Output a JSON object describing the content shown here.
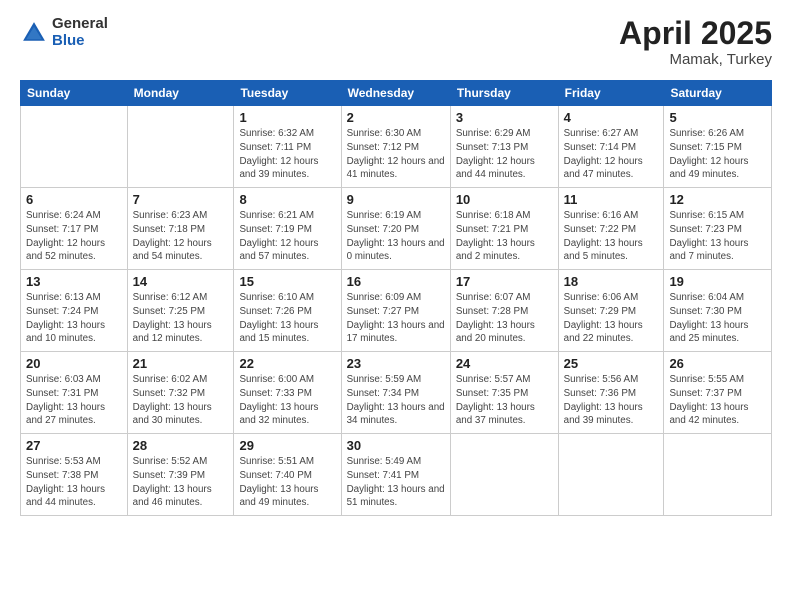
{
  "logo": {
    "general": "General",
    "blue": "Blue"
  },
  "title": {
    "month": "April 2025",
    "location": "Mamak, Turkey"
  },
  "days_of_week": [
    "Sunday",
    "Monday",
    "Tuesday",
    "Wednesday",
    "Thursday",
    "Friday",
    "Saturday"
  ],
  "weeks": [
    [
      {
        "day": "",
        "info": ""
      },
      {
        "day": "",
        "info": ""
      },
      {
        "day": "1",
        "info": "Sunrise: 6:32 AM\nSunset: 7:11 PM\nDaylight: 12 hours and 39 minutes."
      },
      {
        "day": "2",
        "info": "Sunrise: 6:30 AM\nSunset: 7:12 PM\nDaylight: 12 hours and 41 minutes."
      },
      {
        "day": "3",
        "info": "Sunrise: 6:29 AM\nSunset: 7:13 PM\nDaylight: 12 hours and 44 minutes."
      },
      {
        "day": "4",
        "info": "Sunrise: 6:27 AM\nSunset: 7:14 PM\nDaylight: 12 hours and 47 minutes."
      },
      {
        "day": "5",
        "info": "Sunrise: 6:26 AM\nSunset: 7:15 PM\nDaylight: 12 hours and 49 minutes."
      }
    ],
    [
      {
        "day": "6",
        "info": "Sunrise: 6:24 AM\nSunset: 7:17 PM\nDaylight: 12 hours and 52 minutes."
      },
      {
        "day": "7",
        "info": "Sunrise: 6:23 AM\nSunset: 7:18 PM\nDaylight: 12 hours and 54 minutes."
      },
      {
        "day": "8",
        "info": "Sunrise: 6:21 AM\nSunset: 7:19 PM\nDaylight: 12 hours and 57 minutes."
      },
      {
        "day": "9",
        "info": "Sunrise: 6:19 AM\nSunset: 7:20 PM\nDaylight: 13 hours and 0 minutes."
      },
      {
        "day": "10",
        "info": "Sunrise: 6:18 AM\nSunset: 7:21 PM\nDaylight: 13 hours and 2 minutes."
      },
      {
        "day": "11",
        "info": "Sunrise: 6:16 AM\nSunset: 7:22 PM\nDaylight: 13 hours and 5 minutes."
      },
      {
        "day": "12",
        "info": "Sunrise: 6:15 AM\nSunset: 7:23 PM\nDaylight: 13 hours and 7 minutes."
      }
    ],
    [
      {
        "day": "13",
        "info": "Sunrise: 6:13 AM\nSunset: 7:24 PM\nDaylight: 13 hours and 10 minutes."
      },
      {
        "day": "14",
        "info": "Sunrise: 6:12 AM\nSunset: 7:25 PM\nDaylight: 13 hours and 12 minutes."
      },
      {
        "day": "15",
        "info": "Sunrise: 6:10 AM\nSunset: 7:26 PM\nDaylight: 13 hours and 15 minutes."
      },
      {
        "day": "16",
        "info": "Sunrise: 6:09 AM\nSunset: 7:27 PM\nDaylight: 13 hours and 17 minutes."
      },
      {
        "day": "17",
        "info": "Sunrise: 6:07 AM\nSunset: 7:28 PM\nDaylight: 13 hours and 20 minutes."
      },
      {
        "day": "18",
        "info": "Sunrise: 6:06 AM\nSunset: 7:29 PM\nDaylight: 13 hours and 22 minutes."
      },
      {
        "day": "19",
        "info": "Sunrise: 6:04 AM\nSunset: 7:30 PM\nDaylight: 13 hours and 25 minutes."
      }
    ],
    [
      {
        "day": "20",
        "info": "Sunrise: 6:03 AM\nSunset: 7:31 PM\nDaylight: 13 hours and 27 minutes."
      },
      {
        "day": "21",
        "info": "Sunrise: 6:02 AM\nSunset: 7:32 PM\nDaylight: 13 hours and 30 minutes."
      },
      {
        "day": "22",
        "info": "Sunrise: 6:00 AM\nSunset: 7:33 PM\nDaylight: 13 hours and 32 minutes."
      },
      {
        "day": "23",
        "info": "Sunrise: 5:59 AM\nSunset: 7:34 PM\nDaylight: 13 hours and 34 minutes."
      },
      {
        "day": "24",
        "info": "Sunrise: 5:57 AM\nSunset: 7:35 PM\nDaylight: 13 hours and 37 minutes."
      },
      {
        "day": "25",
        "info": "Sunrise: 5:56 AM\nSunset: 7:36 PM\nDaylight: 13 hours and 39 minutes."
      },
      {
        "day": "26",
        "info": "Sunrise: 5:55 AM\nSunset: 7:37 PM\nDaylight: 13 hours and 42 minutes."
      }
    ],
    [
      {
        "day": "27",
        "info": "Sunrise: 5:53 AM\nSunset: 7:38 PM\nDaylight: 13 hours and 44 minutes."
      },
      {
        "day": "28",
        "info": "Sunrise: 5:52 AM\nSunset: 7:39 PM\nDaylight: 13 hours and 46 minutes."
      },
      {
        "day": "29",
        "info": "Sunrise: 5:51 AM\nSunset: 7:40 PM\nDaylight: 13 hours and 49 minutes."
      },
      {
        "day": "30",
        "info": "Sunrise: 5:49 AM\nSunset: 7:41 PM\nDaylight: 13 hours and 51 minutes."
      },
      {
        "day": "",
        "info": ""
      },
      {
        "day": "",
        "info": ""
      },
      {
        "day": "",
        "info": ""
      }
    ]
  ]
}
